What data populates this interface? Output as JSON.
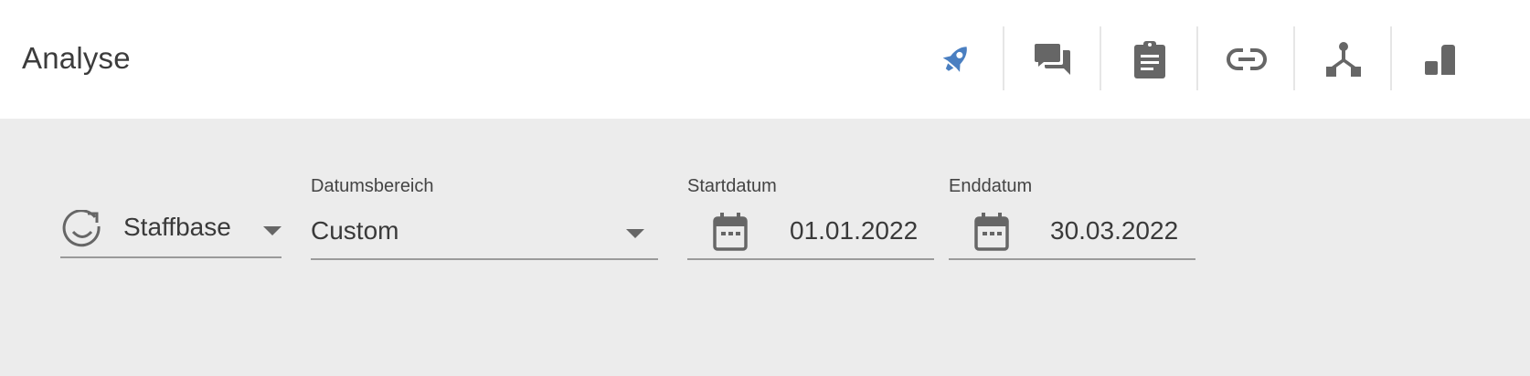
{
  "header": {
    "title": "Analyse",
    "nav_icons": [
      {
        "name": "rocket-icon",
        "active": true
      },
      {
        "name": "chat-icon",
        "active": false
      },
      {
        "name": "clipboard-icon",
        "active": false
      },
      {
        "name": "link-icon",
        "active": false
      },
      {
        "name": "hierarchy-icon",
        "active": false
      },
      {
        "name": "bar-chart-icon",
        "active": false
      }
    ],
    "active_color": "#4a7fc1",
    "icon_color": "#666666"
  },
  "filters": {
    "space": {
      "value": "Staffbase",
      "icon": "staffbase-logo-icon"
    },
    "date_range": {
      "label": "Datumsbereich",
      "value": "Custom"
    },
    "start_date": {
      "label": "Startdatum",
      "value": "01.01.2022",
      "icon": "calendar-icon"
    },
    "end_date": {
      "label": "Enddatum",
      "value": "30.03.2022",
      "icon": "calendar-icon"
    }
  }
}
